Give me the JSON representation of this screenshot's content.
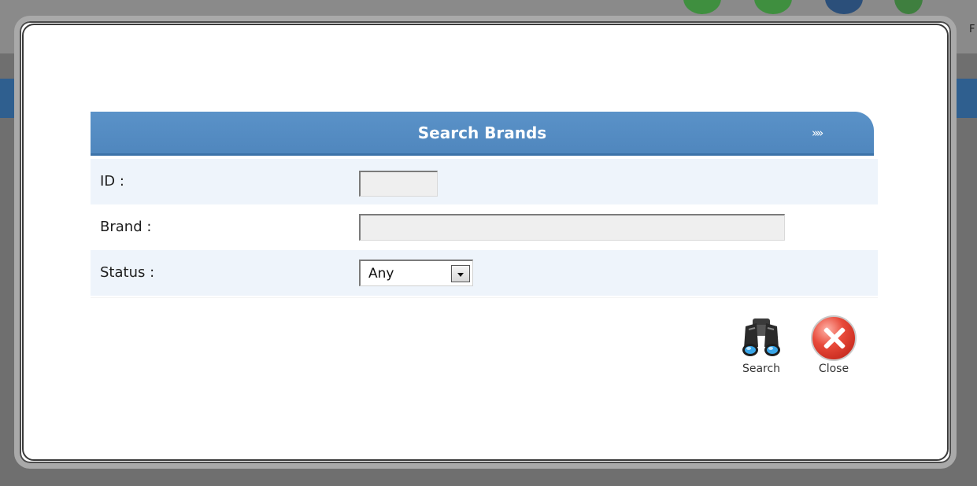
{
  "dialog": {
    "title": "Search Brands",
    "header_arrows": "»»",
    "fields": {
      "id": {
        "label": "ID :",
        "value": ""
      },
      "brand": {
        "label": "Brand :",
        "value": ""
      },
      "status": {
        "label": "Status :",
        "selected": "Any"
      }
    },
    "actions": {
      "search": {
        "label": "Search",
        "icon": "binoculars-icon"
      },
      "close": {
        "label": "Close",
        "icon": "close-icon"
      }
    }
  },
  "background": {
    "edge_text": "F"
  },
  "colors": {
    "header_blue": "#5a92c8",
    "row_alt": "#eef4fb",
    "close_red": "#e84a3a"
  }
}
